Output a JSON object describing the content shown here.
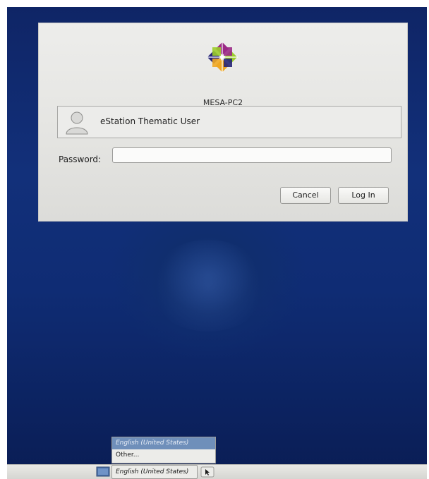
{
  "login": {
    "hostname": "MESA-PC2",
    "user_name": "eStation Thematic User",
    "password_label": "Password:",
    "password_value": "",
    "cancel_label": "Cancel",
    "login_label": "Log In"
  },
  "language_menu": {
    "items": [
      {
        "label": "English (United States)",
        "selected": true
      },
      {
        "label": "Other...",
        "selected": false
      }
    ]
  },
  "panel": {
    "language_button": "English (United States)"
  },
  "icons": {
    "logo": "centos-logo-icon",
    "avatar": "user-avatar-icon",
    "flag": "flag-icon",
    "keyboard": "keyboard-icon"
  },
  "colors": {
    "background": "#12307a",
    "dialog": "#e8e8e5",
    "menu_selected": "#6f8fba"
  }
}
